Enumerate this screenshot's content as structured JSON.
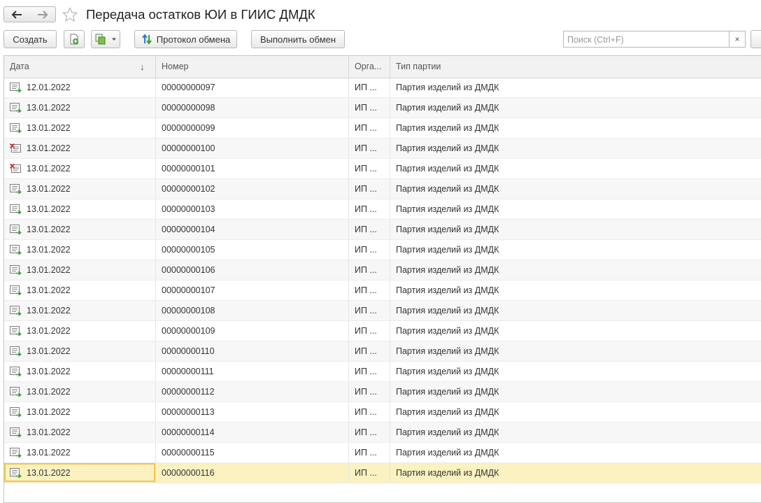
{
  "window": {
    "title": "Передача остатков ЮИ в ГИИС ДМДК"
  },
  "toolbar": {
    "create_label": "Создать",
    "protocol_label": "Протокол обмена",
    "exchange_label": "Выполнить обмен",
    "search_placeholder": "Поиск (Ctrl+F)",
    "search_clear_label": "×"
  },
  "colors": {
    "posted_icon": "#3a9a3a",
    "deleted_mark": "#d23030",
    "selected_row": "#fbf1c1",
    "selected_cell_border": "#f0c64a"
  },
  "table": {
    "columns": {
      "date": "Дата",
      "number": "Номер",
      "org": "Орга...",
      "type": "Тип партии"
    },
    "sort_indicator": "↓",
    "selected_index": 19,
    "rows": [
      {
        "icon": "posted-doc-icon",
        "date": "12.01.2022",
        "number": "00000000097",
        "org": "ИП ...",
        "type": "Партия изделий из ДМДК"
      },
      {
        "icon": "posted-doc-icon",
        "date": "13.01.2022",
        "number": "00000000098",
        "org": "ИП ...",
        "type": "Партия изделий из ДМДК"
      },
      {
        "icon": "posted-doc-icon",
        "date": "13.01.2022",
        "number": "00000000099",
        "org": "ИП ...",
        "type": "Партия изделий из ДМДК"
      },
      {
        "icon": "deleted-doc-icon",
        "date": "13.01.2022",
        "number": "00000000100",
        "org": "ИП ...",
        "type": "Партия изделий из ДМДК"
      },
      {
        "icon": "deleted-doc-icon",
        "date": "13.01.2022",
        "number": "00000000101",
        "org": "ИП ...",
        "type": "Партия изделий из ДМДК"
      },
      {
        "icon": "posted-doc-icon",
        "date": "13.01.2022",
        "number": "00000000102",
        "org": "ИП ...",
        "type": "Партия изделий из ДМДК"
      },
      {
        "icon": "posted-doc-icon",
        "date": "13.01.2022",
        "number": "00000000103",
        "org": "ИП ...",
        "type": "Партия изделий из ДМДК"
      },
      {
        "icon": "posted-doc-icon",
        "date": "13.01.2022",
        "number": "00000000104",
        "org": "ИП ...",
        "type": "Партия изделий из ДМДК"
      },
      {
        "icon": "posted-doc-icon",
        "date": "13.01.2022",
        "number": "00000000105",
        "org": "ИП ...",
        "type": "Партия изделий из ДМДК"
      },
      {
        "icon": "posted-doc-icon",
        "date": "13.01.2022",
        "number": "00000000106",
        "org": "ИП ...",
        "type": "Партия изделий из ДМДК"
      },
      {
        "icon": "posted-doc-icon",
        "date": "13.01.2022",
        "number": "00000000107",
        "org": "ИП ...",
        "type": "Партия изделий из ДМДК"
      },
      {
        "icon": "posted-doc-icon",
        "date": "13.01.2022",
        "number": "00000000108",
        "org": "ИП ...",
        "type": "Партия изделий из ДМДК"
      },
      {
        "icon": "posted-doc-icon",
        "date": "13.01.2022",
        "number": "00000000109",
        "org": "ИП ...",
        "type": "Партия изделий из ДМДК"
      },
      {
        "icon": "posted-doc-icon",
        "date": "13.01.2022",
        "number": "00000000110",
        "org": "ИП ...",
        "type": "Партия изделий из ДМДК"
      },
      {
        "icon": "posted-doc-icon",
        "date": "13.01.2022",
        "number": "00000000111",
        "org": "ИП ...",
        "type": "Партия изделий из ДМДК"
      },
      {
        "icon": "posted-doc-icon",
        "date": "13.01.2022",
        "number": "00000000112",
        "org": "ИП ...",
        "type": "Партия изделий из ДМДК"
      },
      {
        "icon": "posted-doc-icon",
        "date": "13.01.2022",
        "number": "00000000113",
        "org": "ИП ...",
        "type": "Партия изделий из ДМДК"
      },
      {
        "icon": "posted-doc-icon",
        "date": "13.01.2022",
        "number": "00000000114",
        "org": "ИП ...",
        "type": "Партия изделий из ДМДК"
      },
      {
        "icon": "posted-doc-icon",
        "date": "13.01.2022",
        "number": "00000000115",
        "org": "ИП ...",
        "type": "Партия изделий из ДМДК"
      },
      {
        "icon": "posted-doc-icon",
        "date": "13.01.2022",
        "number": "00000000116",
        "org": "ИП ...",
        "type": "Партия изделий из ДМДК"
      }
    ]
  }
}
